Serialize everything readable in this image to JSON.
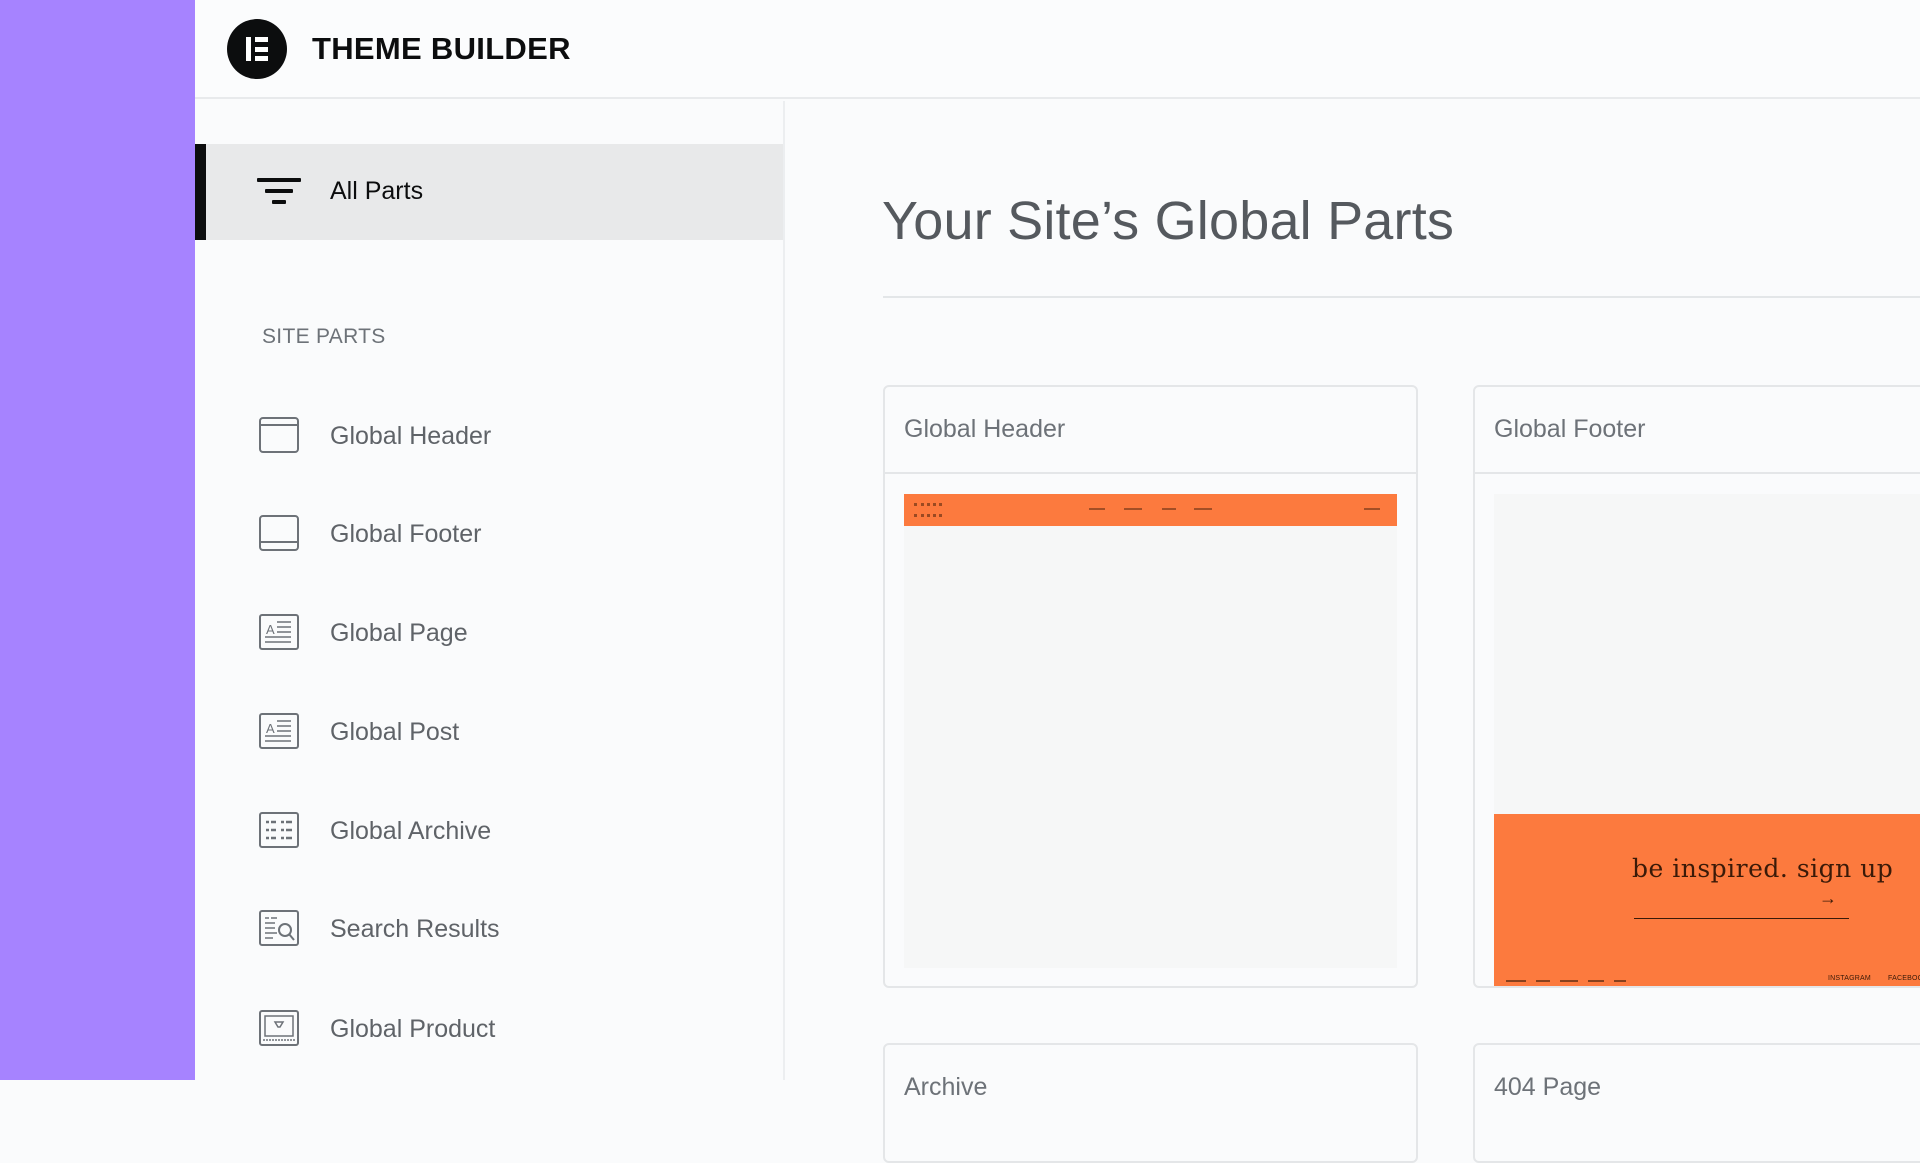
{
  "app": {
    "title": "THEME BUILDER",
    "logo_icon": "elementor-logo-icon"
  },
  "colors": {
    "rail": "#a683ff",
    "accent_orange": "#fc7a3e",
    "active_bg": "#e8e9ea"
  },
  "sidebar": {
    "all_parts": {
      "label": "All Parts",
      "icon": "filter-icon",
      "active": true
    },
    "section_label": "SITE PARTS",
    "items": [
      {
        "label": "Global Header",
        "icon": "header-layout-icon"
      },
      {
        "label": "Global Footer",
        "icon": "footer-layout-icon"
      },
      {
        "label": "Global Page",
        "icon": "page-icon"
      },
      {
        "label": "Global Post",
        "icon": "post-icon"
      },
      {
        "label": "Global Archive",
        "icon": "archive-icon"
      },
      {
        "label": "Search Results",
        "icon": "search-results-icon"
      },
      {
        "label": "Global Product",
        "icon": "product-icon"
      }
    ]
  },
  "main": {
    "title": "Your Site’s Global Parts",
    "cards": [
      {
        "title": "Global Header"
      },
      {
        "title": "Global Footer",
        "preview_tagline": "be inspired. sign up",
        "preview_arrow": "→",
        "preview_social": [
          "INSTAGRAM",
          "FACEBOOK"
        ]
      },
      {
        "title": "Archive"
      },
      {
        "title": "404 Page"
      }
    ]
  }
}
